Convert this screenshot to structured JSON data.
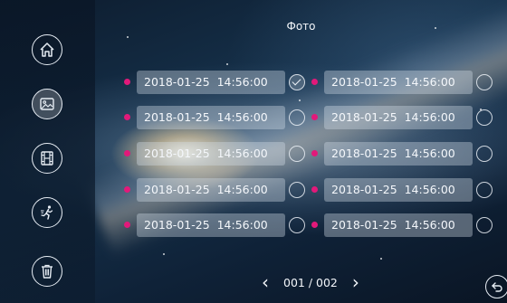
{
  "header": {
    "title": "Фото"
  },
  "sidebar": {
    "items": [
      {
        "icon": "home-icon"
      },
      {
        "icon": "photo-icon",
        "active": true
      },
      {
        "icon": "film-icon"
      },
      {
        "icon": "motion-icon"
      },
      {
        "icon": "trash-icon"
      }
    ]
  },
  "photos": [
    {
      "label": "2018-01-25  14:56:00",
      "checked": true
    },
    {
      "label": "2018-01-25  14:56:00",
      "checked": false
    },
    {
      "label": "2018-01-25  14:56:00",
      "checked": false
    },
    {
      "label": "2018-01-25  14:56:00",
      "checked": false
    },
    {
      "label": "2018-01-25  14:56:00",
      "checked": false
    },
    {
      "label": "2018-01-25  14:56:00",
      "checked": false
    },
    {
      "label": "2018-01-25  14:56:00",
      "checked": false
    },
    {
      "label": "2018-01-25  14:56:00",
      "checked": false
    },
    {
      "label": "2018-01-25  14:56:00",
      "checked": false
    },
    {
      "label": "2018-01-25  14:56:00",
      "checked": false
    }
  ],
  "pager": {
    "prev": "‹",
    "page": "001 / 002",
    "next": "›"
  },
  "footer": {
    "back_icon": "back-icon"
  },
  "colors": {
    "marker": "#e2197a",
    "accent": "#e7edf4"
  }
}
